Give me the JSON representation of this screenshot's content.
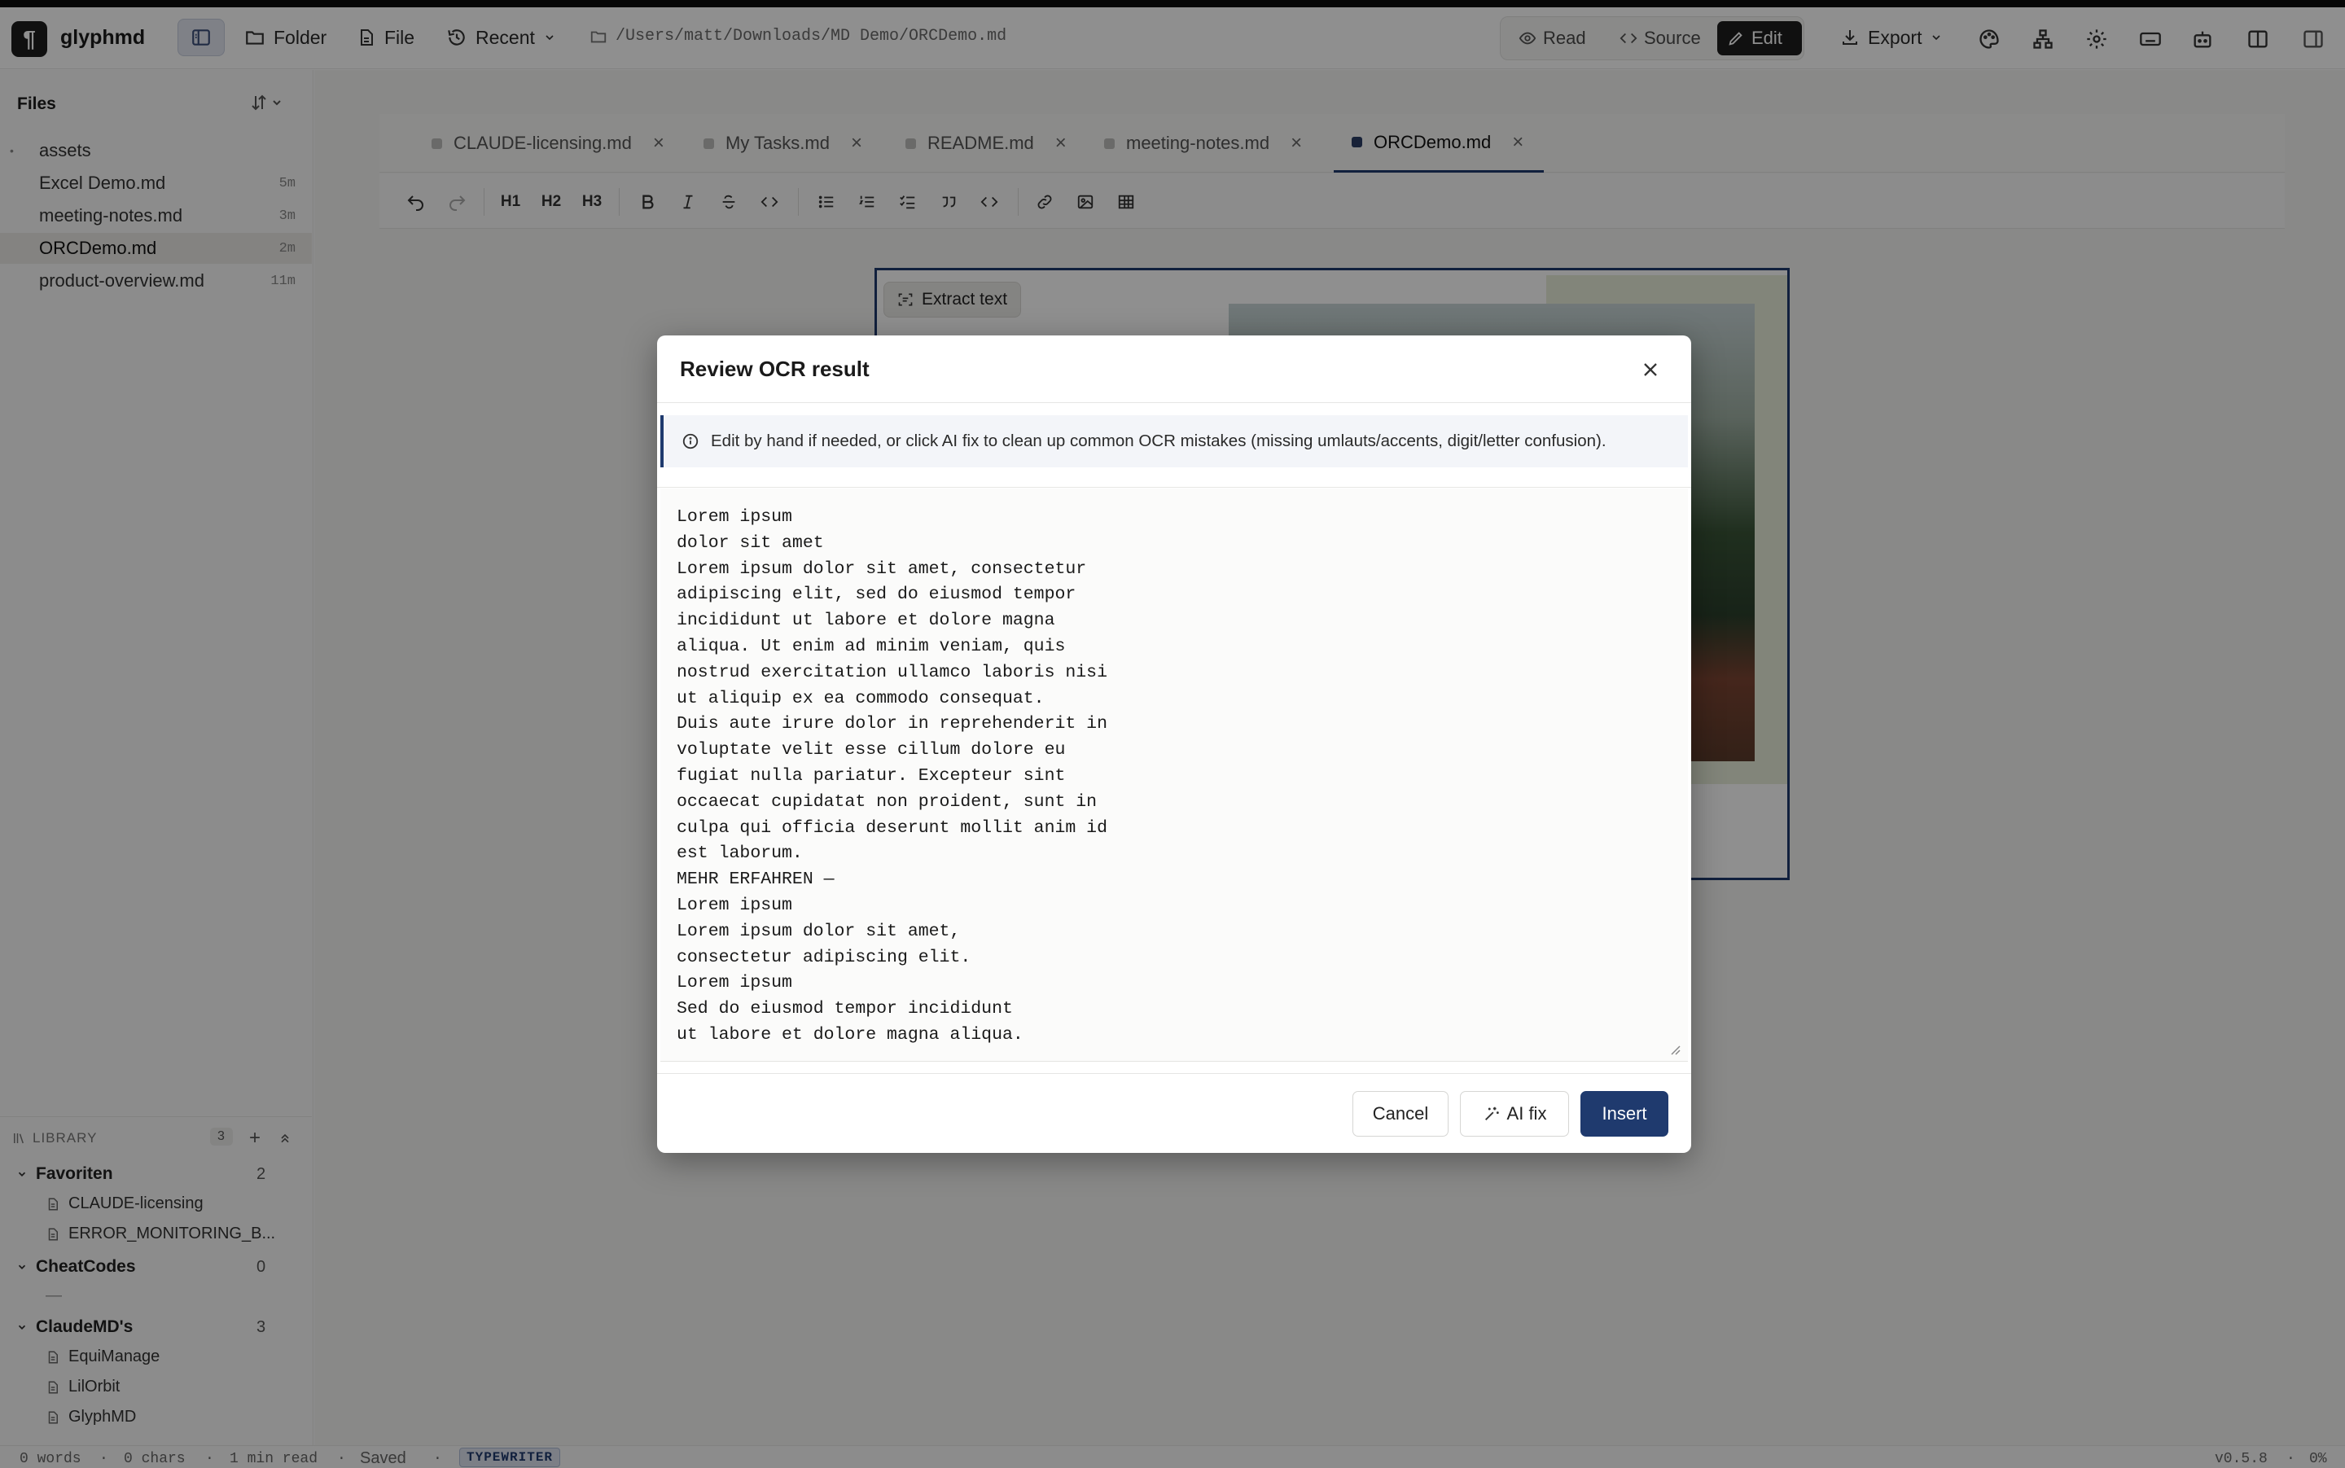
{
  "app": {
    "name": "glyphmd",
    "logo_glyph": "¶",
    "path": "/Users/matt/Downloads/MD Demo/ORCDemo.md"
  },
  "toolbar": {
    "folder_label": "Folder",
    "file_label": "File",
    "recent_label": "Recent",
    "read_label": "Read",
    "source_label": "Source",
    "edit_label": "Edit",
    "export_label": "Export"
  },
  "sidebar": {
    "title": "Files",
    "files": [
      {
        "name": "assets",
        "age": ""
      },
      {
        "name": "Excel Demo.md",
        "age": "5m"
      },
      {
        "name": "meeting-notes.md",
        "age": "3m"
      },
      {
        "name": "ORCDemo.md",
        "age": "2m"
      },
      {
        "name": "product-overview.md",
        "age": "11m"
      }
    ],
    "library": {
      "title": "LIBRARY",
      "count": "3",
      "groups": [
        {
          "name": "Favoriten",
          "count": "2",
          "docs": [
            "CLAUDE-licensing",
            "ERROR_MONITORING_B..."
          ]
        },
        {
          "name": "CheatCodes",
          "count": "0",
          "empty": "—"
        },
        {
          "name": "ClaudeMD's",
          "count": "3",
          "docs": [
            "EquiManage",
            "LilOrbit",
            "GlyphMD"
          ]
        }
      ]
    }
  },
  "tabs": [
    {
      "label": "CLAUDE-licensing.md"
    },
    {
      "label": "My Tasks.md"
    },
    {
      "label": "README.md"
    },
    {
      "label": "meeting-notes.md"
    },
    {
      "label": "ORCDemo.md"
    }
  ],
  "format": {
    "h1": "H1",
    "h2": "H2",
    "h3": "H3"
  },
  "editor": {
    "extract_label": "Extract text"
  },
  "status": {
    "words": "0 words",
    "chars": "0 chars",
    "read": "1 min read",
    "saved": "Saved",
    "mode": "TYPEWRITER",
    "version": "v0.5.8",
    "percent": "0%",
    "sep": "·"
  },
  "modal": {
    "title": "Review OCR result",
    "info": "Edit by hand if needed, or click AI fix to clean up common OCR mistakes (missing umlauts/accents, digit/letter confusion).",
    "ocr_text": "Lorem ipsum\ndolor sit amet\nLorem ipsum dolor sit amet, consectetur\nadipiscing elit, sed do eiusmod tempor\nincididunt ut labore et dolore magna\naliqua. Ut enim ad minim veniam, quis\nnostrud exercitation ullamco laboris nisi\nut aliquip ex ea commodo consequat.\nDuis aute irure dolor in reprehenderit in\nvoluptate velit esse cillum dolore eu\nfugiat nulla pariatur. Excepteur sint\noccaecat cupidatat non proident, sunt in\nculpa qui officia deserunt mollit anim id\nest laborum.\nMEHR ERFAHREN —\nLorem ipsum\nLorem ipsum dolor sit amet,\nconsectetur adipiscing elit.\nLorem ipsum\nSed do eiusmod tempor incididunt\nut labore et dolore magna aliqua.",
    "cancel_label": "Cancel",
    "aifix_label": "AI fix",
    "insert_label": "Insert"
  },
  "colors": {
    "accent": "#1f3a6e",
    "overlay": "rgba(0,0,0,0.44)"
  }
}
